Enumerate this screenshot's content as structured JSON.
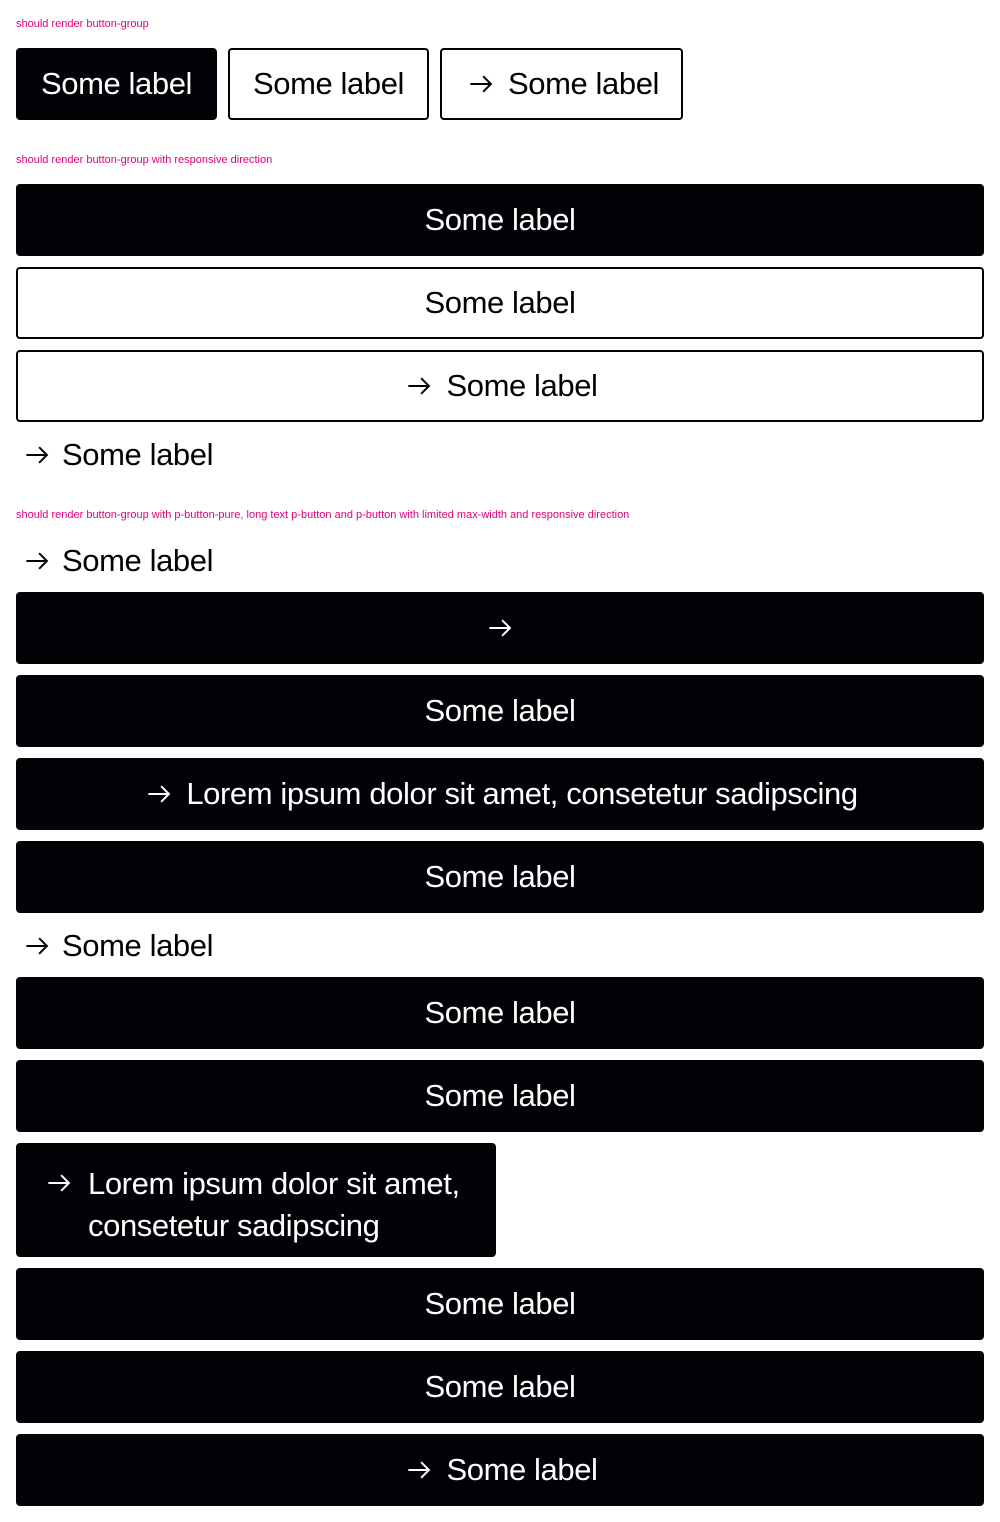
{
  "captions": {
    "group": "should render button-group",
    "responsive": "should render button-group with responsive direction",
    "mixed": "should render button-group with p-button-pure, long text p-button and p-button with limited max-width and responsive direction"
  },
  "labels": {
    "some": "Some label",
    "lorem": "Lorem ipsum dolor sit amet, consetetur sadipscing"
  },
  "icons": {
    "arrow": "arrow-right-icon"
  },
  "colors": {
    "primary": "#010205",
    "caption": "#e2007a",
    "background": "#ffffff"
  }
}
